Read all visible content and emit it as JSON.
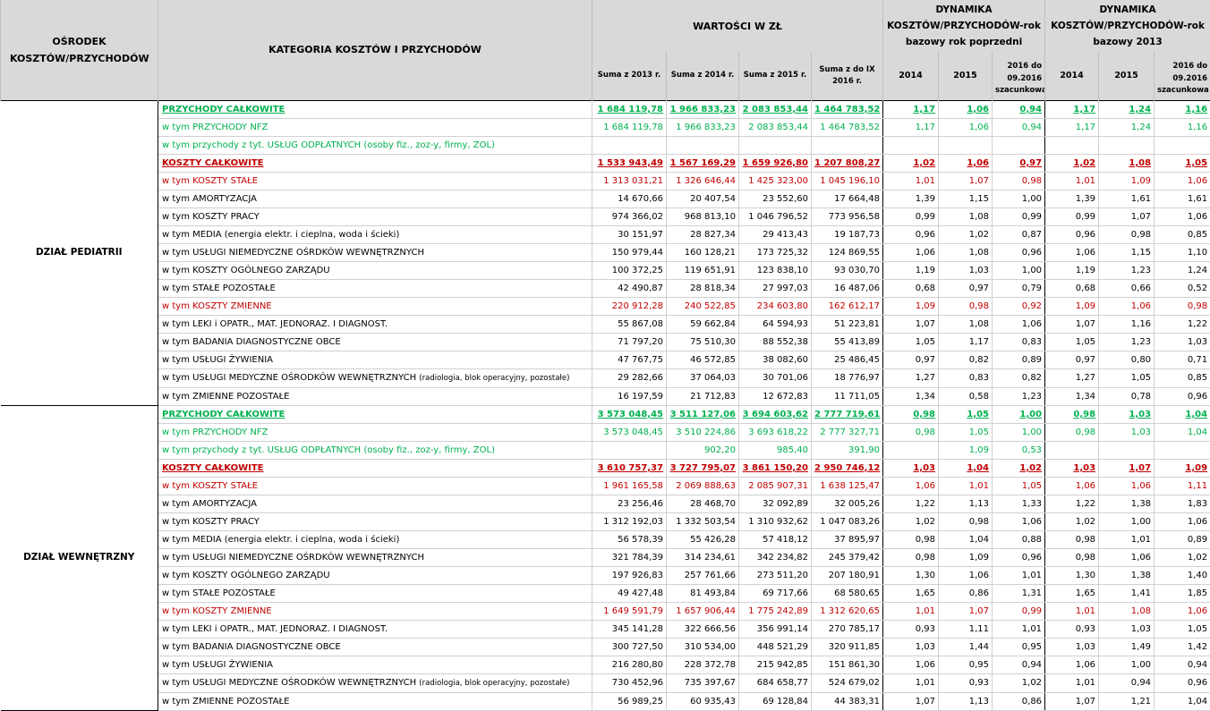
{
  "header": {
    "col_center": "OŚRODEK KOSZTÓW/PRZYCHODÓW",
    "col_category": "KATEGORIA KOSZTÓW I PRZYCHODÓW",
    "group_values": "WARTOŚCI W ZŁ",
    "group_dyn_prev": "DYNAMIKA KOSZTÓW/PRZYCHODÓW-rok bazowy rok poprzedni",
    "group_dyn_2013": "DYNAMIKA KOSZTÓW/PRZYCHODÓW-rok bazowy 2013",
    "sum_cols": [
      "Suma z 2013 r.",
      "Suma z 2014 r.",
      "Suma z 2015 r.",
      "Suma z do IX 2016 r."
    ],
    "dyn_prev_cols": [
      "2014",
      "2015",
      "2016 do 09.2016 szacunkowa"
    ],
    "dyn_2013_cols": [
      "2014",
      "2015",
      "2016 do 09.2016 szacunkowa"
    ]
  },
  "sections": [
    {
      "name": "DZIAŁ PEDIATRII",
      "rows": [
        {
          "cat": "PRZYCHODY CAŁKOWITE",
          "style": "green-bold",
          "values": [
            "1 684 119,78",
            "1 966 833,23",
            "2 083 853,44",
            "1 464 783,52",
            "1,17",
            "1,06",
            "0,94",
            "1,17",
            "1,24",
            "1,16"
          ]
        },
        {
          "cat": "w tym PRZYCHODY NFZ",
          "style": "green",
          "values": [
            "1 684 119,78",
            "1 966 833,23",
            "2 083 853,44",
            "1 464 783,52",
            "1,17",
            "1,06",
            "0,94",
            "1,17",
            "1,24",
            "1,16"
          ]
        },
        {
          "cat": "w tym przychody z tyt. USŁUG ODPŁATNYCH (osoby fiz., zoz-y, firmy, ZOL)",
          "style": "green",
          "values": [
            "",
            "",
            "",
            "",
            "",
            "",
            "",
            "",
            "",
            ""
          ]
        },
        {
          "cat": "KOSZTY CAŁKOWITE",
          "style": "red-bold",
          "values": [
            "1 533 943,49",
            "1 567 169,29",
            "1 659 926,80",
            "1 207 808,27",
            "1,02",
            "1,06",
            "0,97",
            "1,02",
            "1,08",
            "1,05"
          ]
        },
        {
          "cat": "w tym KOSZTY STAŁE",
          "style": "red",
          "values": [
            "1 313 031,21",
            "1 326 646,44",
            "1 425 323,00",
            "1 045 196,10",
            "1,01",
            "1,07",
            "0,98",
            "1,01",
            "1,09",
            "1,06"
          ]
        },
        {
          "cat": "w tym AMORTYZACJA",
          "style": "",
          "values": [
            "14 670,66",
            "20 407,54",
            "23 552,60",
            "17 664,48",
            "1,39",
            "1,15",
            "1,00",
            "1,39",
            "1,61",
            "1,61"
          ]
        },
        {
          "cat": "w tym KOSZTY PRACY",
          "style": "",
          "values": [
            "974 366,02",
            "968 813,10",
            "1 046 796,52",
            "773 956,58",
            "0,99",
            "1,08",
            "0,99",
            "0,99",
            "1,07",
            "1,06"
          ]
        },
        {
          "cat": "w tym MEDIA (energia elektr. i cieplna, woda i ścieki)",
          "style": "",
          "values": [
            "30 151,97",
            "28 827,34",
            "29 413,43",
            "19 187,73",
            "0,96",
            "1,02",
            "0,87",
            "0,96",
            "0,98",
            "0,85"
          ]
        },
        {
          "cat": "w tym USŁUGI NIEMEDYCZNE OŚRDKÓW WEWNĘTRZNYCH",
          "style": "",
          "values": [
            "150 979,44",
            "160 128,21",
            "173 725,32",
            "124 869,55",
            "1,06",
            "1,08",
            "0,96",
            "1,06",
            "1,15",
            "1,10"
          ]
        },
        {
          "cat": "w tym KOSZTY OGÓLNEGO ZARZĄDU",
          "style": "",
          "values": [
            "100 372,25",
            "119 651,91",
            "123 838,10",
            "93 030,70",
            "1,19",
            "1,03",
            "1,00",
            "1,19",
            "1,23",
            "1,24"
          ]
        },
        {
          "cat": "w tym STAŁE POZOSTAŁE",
          "style": "",
          "values": [
            "42 490,87",
            "28 818,34",
            "27 997,03",
            "16 487,06",
            "0,68",
            "0,97",
            "0,79",
            "0,68",
            "0,66",
            "0,52"
          ]
        },
        {
          "cat": "w tym KOSZTY ZMIENNE",
          "style": "red",
          "values": [
            "220 912,28",
            "240 522,85",
            "234 603,80",
            "162 612,17",
            "1,09",
            "0,98",
            "0,92",
            "1,09",
            "1,06",
            "0,98"
          ]
        },
        {
          "cat": "w tym LEKI i OPATR., MAT. JEDNORAZ. I DIAGNOST.",
          "style": "",
          "values": [
            "55 867,08",
            "59 662,84",
            "64 594,93",
            "51 223,81",
            "1,07",
            "1,08",
            "1,06",
            "1,07",
            "1,16",
            "1,22"
          ]
        },
        {
          "cat": "w tym BADANIA DIAGNOSTYCZNE OBCE",
          "style": "",
          "values": [
            "71 797,20",
            "75 510,30",
            "88 552,38",
            "55 413,89",
            "1,05",
            "1,17",
            "0,83",
            "1,05",
            "1,23",
            "1,03"
          ]
        },
        {
          "cat": "w tym USŁUGI ŻYWIENIA",
          "style": "",
          "values": [
            "47 767,75",
            "46 572,85",
            "38 082,60",
            "25 486,45",
            "0,97",
            "0,82",
            "0,89",
            "0,97",
            "0,80",
            "0,71"
          ]
        },
        {
          "cat": "w tym USŁUGI MEDYCZNE OŚRODKÓW WEWNĘTRZNYCH",
          "cat_small": "(radiologia, blok operacyjny, pozostałe)",
          "style": "",
          "values": [
            "29 282,66",
            "37 064,03",
            "30 701,06",
            "18 776,97",
            "1,27",
            "0,83",
            "0,82",
            "1,27",
            "1,05",
            "0,85"
          ]
        },
        {
          "cat": "w tym ZMIENNE POZOSTAŁE",
          "style": "",
          "values": [
            "16 197,59",
            "21 712,83",
            "12 672,83",
            "11 711,05",
            "1,34",
            "0,58",
            "1,23",
            "1,34",
            "0,78",
            "0,96"
          ]
        }
      ]
    },
    {
      "name": "DZIAŁ WEWNĘTRZNY",
      "rows": [
        {
          "cat": "PRZYCHODY CAŁKOWITE",
          "style": "green-bold",
          "values": [
            "3 573 048,45",
            "3 511 127,06",
            "3 694 603,62",
            "2 777 719,61",
            "0,98",
            "1,05",
            "1,00",
            "0,98",
            "1,03",
            "1,04"
          ]
        },
        {
          "cat": "w tym PRZYCHODY NFZ",
          "style": "green",
          "values": [
            "3 573 048,45",
            "3 510 224,86",
            "3 693 618,22",
            "2 777 327,71",
            "0,98",
            "1,05",
            "1,00",
            "0,98",
            "1,03",
            "1,04"
          ]
        },
        {
          "cat": "w tym przychody z tyt. USŁUG ODPŁATNYCH (osoby fiz., zoz-y, firmy, ZOL)",
          "style": "green",
          "values": [
            "",
            "902,20",
            "985,40",
            "391,90",
            "",
            "1,09",
            "0,53",
            "",
            "",
            ""
          ]
        },
        {
          "cat": "KOSZTY CAŁKOWITE",
          "style": "red-bold",
          "values": [
            "3 610 757,37",
            "3 727 795,07",
            "3 861 150,20",
            "2 950 746,12",
            "1,03",
            "1,04",
            "1,02",
            "1,03",
            "1,07",
            "1,09"
          ]
        },
        {
          "cat": "w tym KOSZTY STAŁE",
          "style": "red",
          "values": [
            "1 961 165,58",
            "2 069 888,63",
            "2 085 907,31",
            "1 638 125,47",
            "1,06",
            "1,01",
            "1,05",
            "1,06",
            "1,06",
            "1,11"
          ]
        },
        {
          "cat": "w tym AMORTYZACJA",
          "style": "",
          "values": [
            "23 256,46",
            "28 468,70",
            "32 092,89",
            "32 005,26",
            "1,22",
            "1,13",
            "1,33",
            "1,22",
            "1,38",
            "1,83"
          ]
        },
        {
          "cat": "w tym KOSZTY PRACY",
          "style": "",
          "values": [
            "1 312 192,03",
            "1 332 503,54",
            "1 310 932,62",
            "1 047 083,26",
            "1,02",
            "0,98",
            "1,06",
            "1,02",
            "1,00",
            "1,06"
          ]
        },
        {
          "cat": "w tym MEDIA (energia elektr. i cieplna, woda i ścieki)",
          "style": "",
          "values": [
            "56 578,39",
            "55 426,28",
            "57 418,12",
            "37 895,97",
            "0,98",
            "1,04",
            "0,88",
            "0,98",
            "1,01",
            "0,89"
          ]
        },
        {
          "cat": "w tym USŁUGI NIEMEDYCZNE OŚRDKÓW WEWNĘTRZNYCH",
          "style": "",
          "values": [
            "321 784,39",
            "314 234,61",
            "342 234,82",
            "245 379,42",
            "0,98",
            "1,09",
            "0,96",
            "0,98",
            "1,06",
            "1,02"
          ]
        },
        {
          "cat": "w tym KOSZTY OGÓLNEGO ZARZĄDU",
          "style": "",
          "values": [
            "197 926,83",
            "257 761,66",
            "273 511,20",
            "207 180,91",
            "1,30",
            "1,06",
            "1,01",
            "1,30",
            "1,38",
            "1,40"
          ]
        },
        {
          "cat": "w tym STAŁE POZOSTAŁE",
          "style": "",
          "values": [
            "49 427,48",
            "81 493,84",
            "69 717,66",
            "68 580,65",
            "1,65",
            "0,86",
            "1,31",
            "1,65",
            "1,41",
            "1,85"
          ]
        },
        {
          "cat": "w tym KOSZTY ZMIENNE",
          "style": "red",
          "values": [
            "1 649 591,79",
            "1 657 906,44",
            "1 775 242,89",
            "1 312 620,65",
            "1,01",
            "1,07",
            "0,99",
            "1,01",
            "1,08",
            "1,06"
          ]
        },
        {
          "cat": "w tym LEKI i OPATR., MAT. JEDNORAZ. I DIAGNOST.",
          "style": "",
          "values": [
            "345 141,28",
            "322 666,56",
            "356 991,14",
            "270 785,17",
            "0,93",
            "1,11",
            "1,01",
            "0,93",
            "1,03",
            "1,05"
          ]
        },
        {
          "cat": "w tym BADANIA DIAGNOSTYCZNE OBCE",
          "style": "",
          "values": [
            "300 727,50",
            "310 534,00",
            "448 521,29",
            "320 911,85",
            "1,03",
            "1,44",
            "0,95",
            "1,03",
            "1,49",
            "1,42"
          ]
        },
        {
          "cat": "w tym USŁUGI ŻYWIENIA",
          "style": "",
          "values": [
            "216 280,80",
            "228 372,78",
            "215 942,85",
            "151 861,30",
            "1,06",
            "0,95",
            "0,94",
            "1,06",
            "1,00",
            "0,94"
          ]
        },
        {
          "cat": "w tym USŁUGI MEDYCZNE OŚRODKÓW WEWNĘTRZNYCH",
          "cat_small": "(radiologia, blok operacyjny, pozostałe)",
          "style": "",
          "values": [
            "730 452,96",
            "735 397,67",
            "684 658,77",
            "524 679,02",
            "1,01",
            "0,93",
            "1,02",
            "1,01",
            "0,94",
            "0,96"
          ]
        },
        {
          "cat": "w tym ZMIENNE POZOSTAŁE",
          "style": "",
          "values": [
            "56 989,25",
            "60 935,43",
            "69 128,84",
            "44 383,31",
            "1,07",
            "1,13",
            "0,86",
            "1,07",
            "1,21",
            "1,04"
          ]
        }
      ]
    }
  ]
}
